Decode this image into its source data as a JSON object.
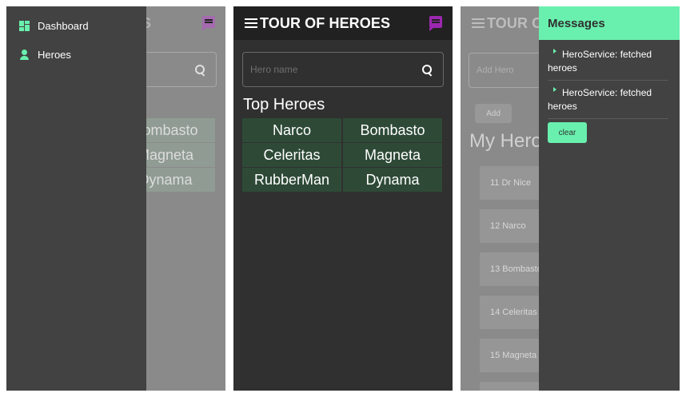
{
  "app": {
    "title": "TOUR OF HEROES"
  },
  "drawer": {
    "items": [
      {
        "label": "Dashboard",
        "icon": "dashboard-icon"
      },
      {
        "label": "Heroes",
        "icon": "person-icon"
      }
    ]
  },
  "dashboard": {
    "search_placeholder": "Hero name",
    "section_title": "Top Heroes",
    "top_heroes": [
      "Narco",
      "Bombasto",
      "Celeritas",
      "Magneta",
      "RubberMan",
      "Dynama"
    ]
  },
  "heroes_page": {
    "add_placeholder": "Add Hero",
    "add_button": "Add",
    "title": "My Heroes",
    "heroes": [
      "11 Dr Nice",
      "12 Narco",
      "13 Bombasto",
      "14 Celeritas",
      "15 Magneta"
    ]
  },
  "messages": {
    "title": "Messages",
    "items": [
      "HeroService: fetched heroes",
      "HeroService: fetched heroes"
    ],
    "clear_label": "clear"
  },
  "colors": {
    "accent": "#69f0ae",
    "tile": "#2e4a37",
    "toolbar": "#212121",
    "message_icon": "#9c27b0"
  }
}
